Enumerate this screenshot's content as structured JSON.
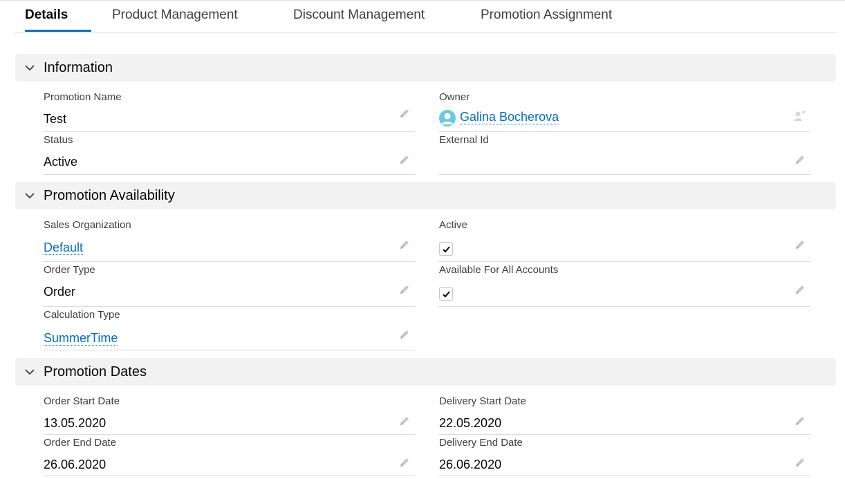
{
  "tabs": [
    {
      "label": "Details",
      "active": true
    },
    {
      "label": "Product Management",
      "active": false
    },
    {
      "label": "Discount Management",
      "active": false
    },
    {
      "label": "Promotion Assignment",
      "active": false
    }
  ],
  "sections": {
    "information": {
      "title": "Information",
      "promotion_name": {
        "label": "Promotion Name",
        "value": "Test"
      },
      "owner": {
        "label": "Owner",
        "value": "Galina Bocherova"
      },
      "status": {
        "label": "Status",
        "value": "Active"
      },
      "external_id": {
        "label": "External Id",
        "value": ""
      }
    },
    "availability": {
      "title": "Promotion Availability",
      "sales_organization": {
        "label": "Sales Organization",
        "value": "Default"
      },
      "active": {
        "label": "Active",
        "checked": true
      },
      "order_type": {
        "label": "Order Type",
        "value": "Order"
      },
      "available_for_all_accounts": {
        "label": "Available For All Accounts",
        "checked": true
      },
      "calculation_type": {
        "label": "Calculation Type",
        "value": "SummerTime"
      }
    },
    "dates": {
      "title": "Promotion Dates",
      "order_start_date": {
        "label": "Order Start Date",
        "value": "13.05.2020"
      },
      "delivery_start_date": {
        "label": "Delivery Start Date",
        "value": "22.05.2020"
      },
      "order_end_date": {
        "label": "Order End Date",
        "value": "26.06.2020"
      },
      "delivery_end_date": {
        "label": "Delivery End Date",
        "value": "26.06.2020"
      }
    }
  },
  "icons": {
    "section_toggle": "chevron-down-icon",
    "edit": "pencil-icon",
    "owner_avatar": "user-avatar-icon",
    "change_owner": "change-owner-icon",
    "checkbox": "checkmark-icon"
  },
  "colors": {
    "accent": "#0070d2",
    "link": "#006dcc",
    "section_bg": "#f3f2f2",
    "avatar": "#65cae4"
  }
}
